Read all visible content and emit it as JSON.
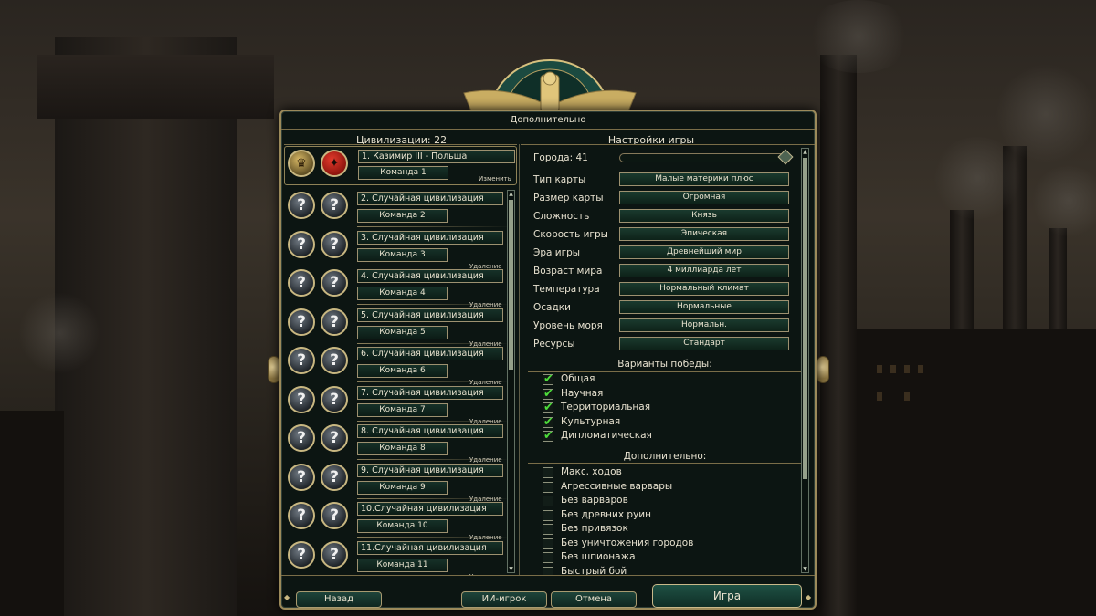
{
  "panel": {
    "title": "Дополнительно"
  },
  "civilizations": {
    "header": "Цивилизации: 22",
    "rows": [
      {
        "name": "1.      Казимир III - Польша",
        "team": "Команда 1",
        "action": "Изменить",
        "leader": true
      },
      {
        "name": "2.  Случайная цивилизация",
        "team": "Команда 2",
        "action": ""
      },
      {
        "name": "3.  Случайная цивилизация",
        "team": "Команда 3",
        "action": "Удаление"
      },
      {
        "name": "4.  Случайная цивилизация",
        "team": "Команда 4",
        "action": "Удаление"
      },
      {
        "name": "5.  Случайная цивилизация",
        "team": "Команда 5",
        "action": "Удаление"
      },
      {
        "name": "6.  Случайная цивилизация",
        "team": "Команда 6",
        "action": "Удаление"
      },
      {
        "name": "7.  Случайная цивилизация",
        "team": "Команда 7",
        "action": "Удаление"
      },
      {
        "name": "8.  Случайная цивилизация",
        "team": "Команда 8",
        "action": "Удаление"
      },
      {
        "name": "9.  Случайная цивилизация",
        "team": "Команда 9",
        "action": "Удаление"
      },
      {
        "name": "10.Случайная цивилизация",
        "team": "Команда 10",
        "action": "Удаление"
      },
      {
        "name": "11.Случайная цивилизация",
        "team": "Команда 11",
        "action": "Удаление"
      }
    ],
    "unknown_symbol": "?"
  },
  "settings": {
    "header": "Настройки игры",
    "cities_label": "Города: 41",
    "cities_value": 41,
    "rows": [
      {
        "label": "Тип карты",
        "value": "Малые материки плюс"
      },
      {
        "label": "Размер карты",
        "value": "Огромная"
      },
      {
        "label": "Сложность",
        "value": "Князь"
      },
      {
        "label": "Скорость игры",
        "value": "Эпическая"
      },
      {
        "label": "Эра игры",
        "value": "Древнейший мир"
      },
      {
        "label": "Возраст мира",
        "value": "4 миллиарда лет"
      },
      {
        "label": "Температура",
        "value": "Нормальный климат"
      },
      {
        "label": "Осадки",
        "value": "Нормальные"
      },
      {
        "label": "Уровень моря",
        "value": "Нормальн."
      },
      {
        "label": "Ресурсы",
        "value": "Стандарт"
      }
    ],
    "victory_title": "Варианты победы:",
    "victory": [
      {
        "label": "Общая",
        "checked": true
      },
      {
        "label": "Научная",
        "checked": true
      },
      {
        "label": "Территориальная",
        "checked": true
      },
      {
        "label": "Культурная",
        "checked": true
      },
      {
        "label": "Дипломатическая",
        "checked": true
      }
    ],
    "extra_title": "Дополнительно:",
    "extra": [
      {
        "label": "Макс. ходов",
        "checked": false
      },
      {
        "label": "Агрессивные варвары",
        "checked": false
      },
      {
        "label": "Без варваров",
        "checked": false
      },
      {
        "label": "Без древних руин",
        "checked": false
      },
      {
        "label": "Без привязок",
        "checked": false
      },
      {
        "label": "Без уничтожения городов",
        "checked": false
      },
      {
        "label": "Без шпионажа",
        "checked": false
      },
      {
        "label": "Быстрый бой",
        "checked": false
      }
    ]
  },
  "buttons": {
    "back": "Назад",
    "ai_player": "ИИ-игрок",
    "cancel": "Отмена",
    "play": "Игра"
  },
  "colors": {
    "panel_bg": "#0c1512",
    "frame_gold": "#9c8a5a",
    "text": "#e8e2d0",
    "check_green": "#4cdc3a",
    "emblem_red": "#d4281c"
  }
}
